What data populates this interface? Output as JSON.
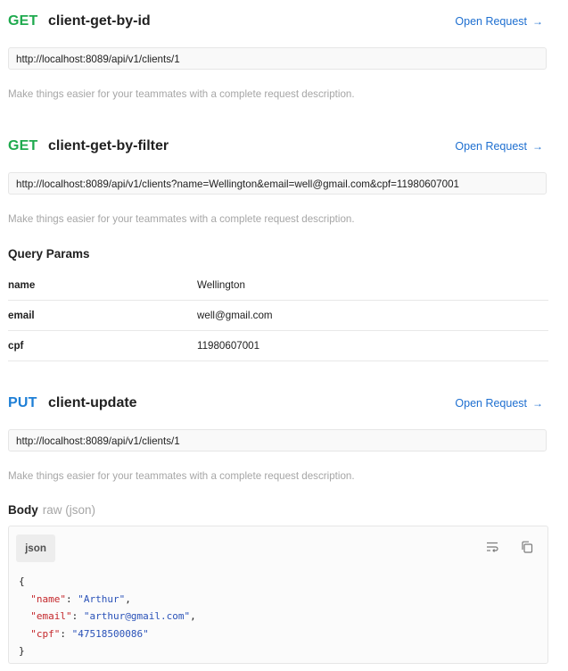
{
  "requests": [
    {
      "method": "GET",
      "name": "client-get-by-id",
      "open_label": "Open Request",
      "url": "http://localhost:8089/api/v1/clients/1",
      "description": "Make things easier for your teammates with a complete request description."
    },
    {
      "method": "GET",
      "name": "client-get-by-filter",
      "open_label": "Open Request",
      "url": "http://localhost:8089/api/v1/clients?name=Wellington&email=well@gmail.com&cpf=11980607001",
      "description": "Make things easier for your teammates with a complete request description.",
      "query_params_title": "Query Params",
      "query_params": [
        {
          "key": "name",
          "value": "Wellington"
        },
        {
          "key": "email",
          "value": "well@gmail.com"
        },
        {
          "key": "cpf",
          "value": "11980607001"
        }
      ]
    },
    {
      "method": "PUT",
      "name": "client-update",
      "open_label": "Open Request",
      "url": "http://localhost:8089/api/v1/clients/1",
      "description": "Make things easier for your teammates with a complete request description.",
      "body_title": "Body",
      "body_mode": "raw (json)",
      "body_lang": "json",
      "body_lines": [
        {
          "text": "{"
        },
        {
          "key": "\"name\"",
          "sep": ": ",
          "value": "\"Arthur\"",
          "tail": ","
        },
        {
          "key": "\"email\"",
          "sep": ": ",
          "value": "\"arthur@gmail.com\"",
          "tail": ","
        },
        {
          "key": "\"cpf\"",
          "sep": ": ",
          "value": "\"47518500086\"",
          "tail": ""
        },
        {
          "text": "}"
        }
      ]
    }
  ],
  "colors": {
    "get": "#1faa4e",
    "put": "#1e7fd6",
    "link": "#1e6fd0",
    "json_key": "#c4272b",
    "json_string": "#2a52b8"
  },
  "icons": {
    "open_request": "arrow-right-icon",
    "wrap": "wrap-lines-icon",
    "copy": "copy-icon"
  }
}
